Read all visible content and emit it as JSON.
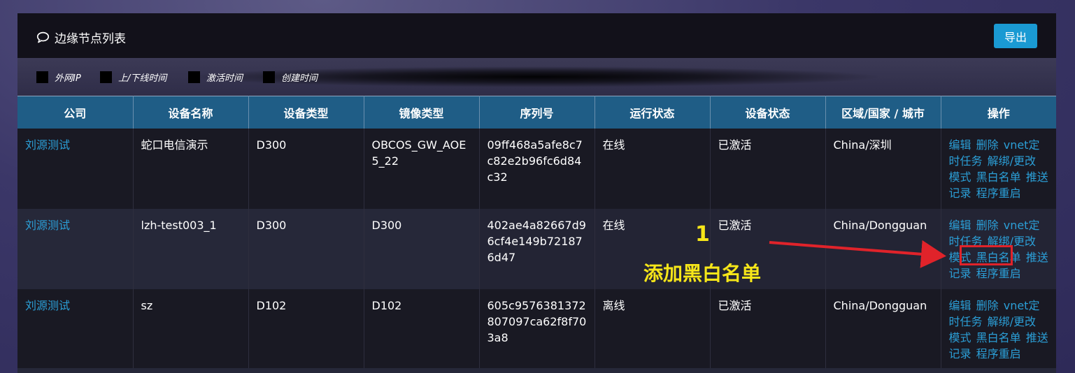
{
  "header": {
    "title": "边缘节点列表",
    "export_label": "导出"
  },
  "filters": [
    "外网IP",
    "上/下线时间",
    "激活时间",
    "创建时间"
  ],
  "table": {
    "columns": [
      "公司",
      "设备名称",
      "设备类型",
      "镜像类型",
      "序列号",
      "运行状态",
      "设备状态",
      "区域/国家 / 城市",
      "操作"
    ],
    "rows": [
      {
        "company": "刘源测试",
        "device_name": "蛇口电信演示",
        "device_type": "D300",
        "image_type": "OBCOS_GW_AOE5_22",
        "serial": "09ff468a5afe8c7c82e2b96fc6d84c32",
        "run_status": "在线",
        "device_status": "已激活",
        "region": "China/深圳"
      },
      {
        "company": "刘源测试",
        "device_name": "lzh-test003_1",
        "device_type": "D300",
        "image_type": "D300",
        "serial": "402ae4a82667d96cf4e149b721876d47",
        "run_status": "在线",
        "device_status": "已激活",
        "region": "China/Dongguan"
      },
      {
        "company": "刘源测试",
        "device_name": "sz",
        "device_type": "D102",
        "image_type": "D102",
        "serial": "605c9576381372807097ca62f8f703a8",
        "run_status": "离线",
        "device_status": "已激活",
        "region": "China/Dongguan"
      }
    ],
    "actions": [
      "编辑",
      "删除",
      "vnet定时任务",
      "解绑/更改",
      "模式",
      "黑白名单",
      "推送记录",
      "程序重启"
    ]
  },
  "annotation": {
    "number": "1",
    "text": "添加黑白名单",
    "color": "#f6e619",
    "highlight_color": "#e0232a"
  }
}
